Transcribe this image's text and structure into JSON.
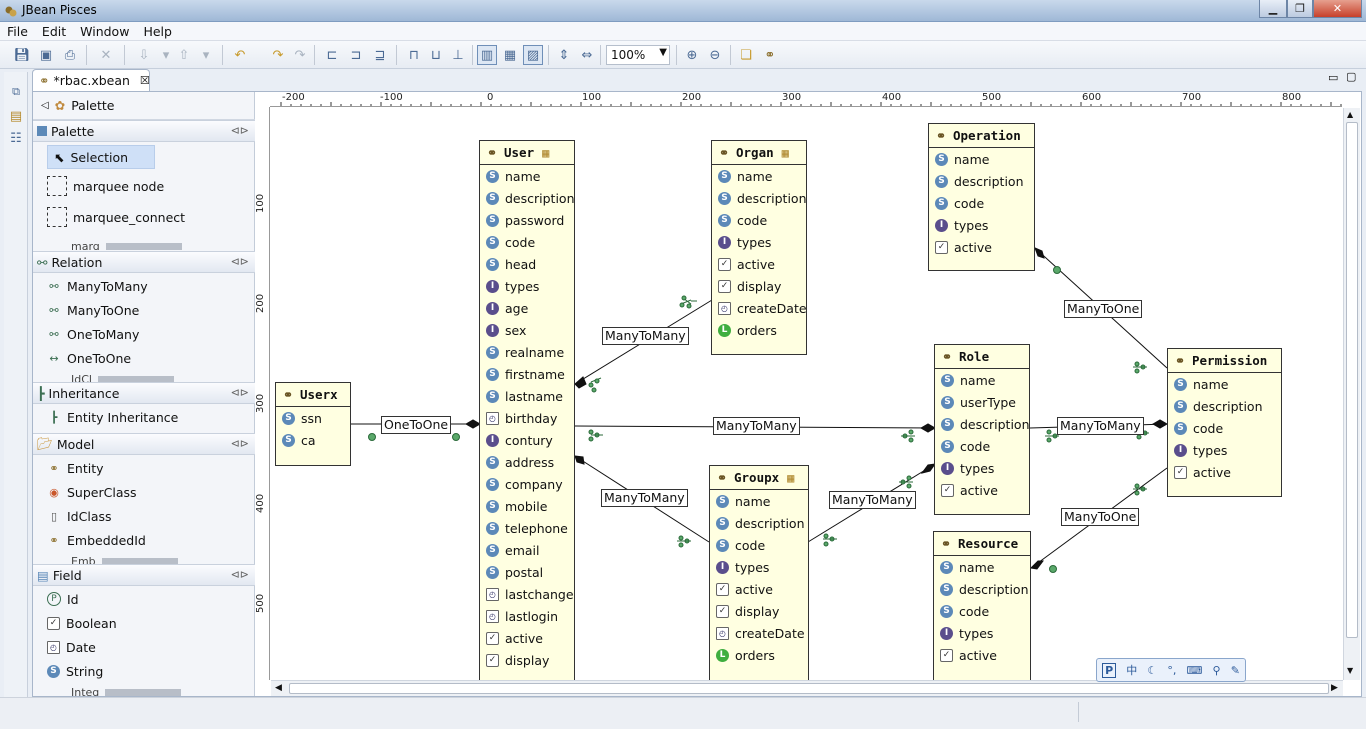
{
  "window": {
    "title": "JBean Pisces"
  },
  "menu": [
    "File",
    "Edit",
    "Window",
    "Help"
  ],
  "toolbar": {
    "zoom": "100%"
  },
  "editor": {
    "tab_title": "*rbac.xbean"
  },
  "palette": {
    "title": "Palette",
    "drawers": [
      {
        "label": "Palette",
        "items": [
          {
            "label": "Selection",
            "icon": "arrow-pointer-icon"
          },
          {
            "label": "marquee node",
            "icon": "marquee-node-icon"
          },
          {
            "label": "marquee_connect",
            "icon": "marquee-connect-icon"
          }
        ],
        "truncated": "marq"
      },
      {
        "label": "Relation",
        "items": [
          {
            "label": "ManyToMany",
            "icon": "relation-icon"
          },
          {
            "label": "ManyToOne",
            "icon": "relation-icon"
          },
          {
            "label": "OneToMany",
            "icon": "relation-icon"
          },
          {
            "label": "OneToOne",
            "icon": "one-to-one-icon"
          }
        ],
        "truncated": "IdCl"
      },
      {
        "label": "Inheritance",
        "items": [
          {
            "label": "Entity Inheritance",
            "icon": "inheritance-icon"
          }
        ]
      },
      {
        "label": "Model",
        "items": [
          {
            "label": "Entity",
            "icon": "entity-icon"
          },
          {
            "label": "SuperClass",
            "icon": "superclass-icon"
          },
          {
            "label": "IdClass",
            "icon": "idclass-icon"
          },
          {
            "label": "EmbeddedId",
            "icon": "embeddedid-icon"
          }
        ],
        "truncated": "Emb"
      },
      {
        "label": "Field",
        "items": [
          {
            "label": "Id",
            "icon": "id-icon"
          },
          {
            "label": "Boolean",
            "icon": "checkbox-icon"
          },
          {
            "label": "Date",
            "icon": "date-icon"
          },
          {
            "label": "String",
            "icon": "string-icon"
          }
        ],
        "truncated": "Integ"
      }
    ]
  },
  "ruler": {
    "h": [
      "-200",
      "-100",
      "0",
      "100",
      "200",
      "300",
      "400",
      "500",
      "600",
      "700",
      "800"
    ],
    "v": [
      "100",
      "200",
      "300",
      "400",
      "500"
    ]
  },
  "entities": {
    "user": {
      "name": "User",
      "fields": [
        {
          "n": "name",
          "t": "S"
        },
        {
          "n": "description",
          "t": "S"
        },
        {
          "n": "password",
          "t": "S"
        },
        {
          "n": "code",
          "t": "S"
        },
        {
          "n": "head",
          "t": "S"
        },
        {
          "n": "types",
          "t": "I"
        },
        {
          "n": "age",
          "t": "I"
        },
        {
          "n": "sex",
          "t": "I"
        },
        {
          "n": "realname",
          "t": "S"
        },
        {
          "n": "firstname",
          "t": "S"
        },
        {
          "n": "lastname",
          "t": "S"
        },
        {
          "n": "birthday",
          "t": "D"
        },
        {
          "n": "contury",
          "t": "I"
        },
        {
          "n": "address",
          "t": "S"
        },
        {
          "n": "company",
          "t": "S"
        },
        {
          "n": "mobile",
          "t": "S"
        },
        {
          "n": "telephone",
          "t": "S"
        },
        {
          "n": "email",
          "t": "S"
        },
        {
          "n": "postal",
          "t": "S"
        },
        {
          "n": "lastchange",
          "t": "D"
        },
        {
          "n": "lastlogin",
          "t": "D"
        },
        {
          "n": "active",
          "t": "C"
        },
        {
          "n": "display",
          "t": "C"
        }
      ]
    },
    "organ": {
      "name": "Organ",
      "fields": [
        {
          "n": "name",
          "t": "S"
        },
        {
          "n": "description",
          "t": "S"
        },
        {
          "n": "code",
          "t": "S"
        },
        {
          "n": "types",
          "t": "I"
        },
        {
          "n": "active",
          "t": "C"
        },
        {
          "n": "display",
          "t": "C"
        },
        {
          "n": "createDate",
          "t": "D"
        },
        {
          "n": "orders",
          "t": "L"
        }
      ]
    },
    "operation": {
      "name": "Operation",
      "fields": [
        {
          "n": "name",
          "t": "S"
        },
        {
          "n": "description",
          "t": "S"
        },
        {
          "n": "code",
          "t": "S"
        },
        {
          "n": "types",
          "t": "I"
        },
        {
          "n": "active",
          "t": "C"
        }
      ]
    },
    "userx": {
      "name": "Userx",
      "fields": [
        {
          "n": "ssn",
          "t": "S"
        },
        {
          "n": "ca",
          "t": "S"
        }
      ]
    },
    "role": {
      "name": "Role",
      "fields": [
        {
          "n": "name",
          "t": "S"
        },
        {
          "n": "userType",
          "t": "S"
        },
        {
          "n": "description",
          "t": "S"
        },
        {
          "n": "code",
          "t": "S"
        },
        {
          "n": "types",
          "t": "I"
        },
        {
          "n": "active",
          "t": "C"
        }
      ]
    },
    "permission": {
      "name": "Permission",
      "fields": [
        {
          "n": "name",
          "t": "S"
        },
        {
          "n": "description",
          "t": "S"
        },
        {
          "n": "code",
          "t": "S"
        },
        {
          "n": "types",
          "t": "I"
        },
        {
          "n": "active",
          "t": "C"
        }
      ]
    },
    "groupx": {
      "name": "Groupx",
      "fields": [
        {
          "n": "name",
          "t": "S"
        },
        {
          "n": "description",
          "t": "S"
        },
        {
          "n": "code",
          "t": "S"
        },
        {
          "n": "types",
          "t": "I"
        },
        {
          "n": "active",
          "t": "C"
        },
        {
          "n": "display",
          "t": "C"
        },
        {
          "n": "createDate",
          "t": "D"
        },
        {
          "n": "orders",
          "t": "L"
        }
      ]
    },
    "resource": {
      "name": "Resource",
      "fields": [
        {
          "n": "name",
          "t": "S"
        },
        {
          "n": "description",
          "t": "S"
        },
        {
          "n": "code",
          "t": "S"
        },
        {
          "n": "types",
          "t": "I"
        },
        {
          "n": "active",
          "t": "C"
        }
      ]
    }
  },
  "relations": {
    "userx_user": "OneToOne",
    "user_organ": "ManyToMany",
    "user_role": "ManyToMany",
    "user_groupx": "ManyToMany",
    "groupx_role": "ManyToMany",
    "role_permission": "ManyToMany",
    "operation_permission": "ManyToOne",
    "resource_permission": "ManyToOne"
  },
  "ime": [
    "中",
    "☾",
    "°,",
    "⌨",
    "⚲",
    "✎"
  ]
}
